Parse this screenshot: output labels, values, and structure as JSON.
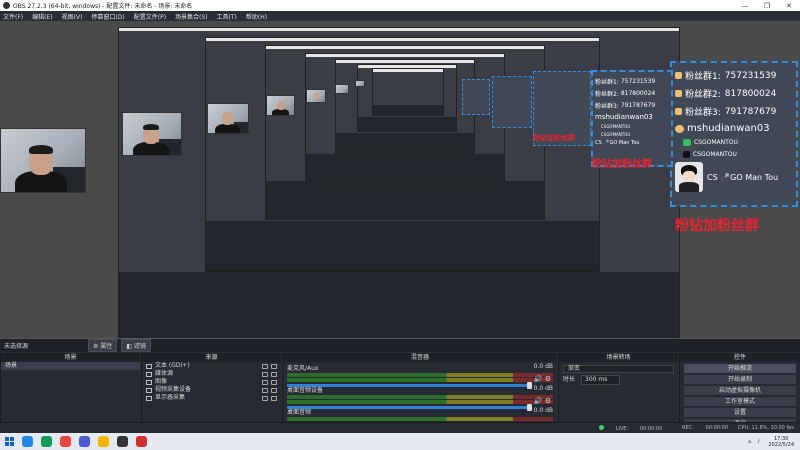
{
  "window": {
    "title": "OBS 27.2.3 (64-bit, windows) - 配置文件: 未命名 - 场景: 未命名",
    "controls": [
      "—",
      "❐",
      "✕"
    ]
  },
  "menu": [
    "文件(F)",
    "编辑(E)",
    "视图(V)",
    "停靠窗口(D)",
    "配置文件(P)",
    "场景集合(S)",
    "工具(T)",
    "帮助(H)"
  ],
  "fan_panel": {
    "rows": [
      {
        "label": "粉丝群1:",
        "value": "757231539"
      },
      {
        "label": "粉丝群2:",
        "value": "817800024"
      },
      {
        "label": "粉丝群3:",
        "value": "791787679"
      }
    ],
    "wechat_handle": "mshudianwan03",
    "wechat_small": "CSGOMANTOU",
    "douyin_handle": "CSGOMANTOU",
    "avatar_caption": "CS 🎤GO Man Tou",
    "avatar_caption_small": "CS 🎤GO Man Tou",
    "red_banner": "粉钻加粉丝群"
  },
  "scene_bar": {
    "label": "未选择源",
    "properties_btn": "⚙ 属性",
    "filters_btn": "◧ 滤镜"
  },
  "scenes": {
    "header": "场景",
    "items": [
      "场景"
    ],
    "footer": [
      "+",
      "−",
      "∧",
      "∨"
    ]
  },
  "sources": {
    "header": "来源",
    "items": [
      "文本 (GDI+)",
      "媒体源",
      "图像",
      "视频采集设备",
      "显示器采集"
    ],
    "footer": [
      "+",
      "−",
      "⚙",
      "∧",
      "∨"
    ]
  },
  "mixer": {
    "header": "混音器",
    "channels": [
      {
        "name": "麦克风/Aux",
        "db": "0.0 dB",
        "level": 0.0
      },
      {
        "name": "桌面音频设备",
        "db": "0.0 dB",
        "level": 0.0
      },
      {
        "name": "桌面音频",
        "db": "0.0 dB",
        "level": 0.0
      }
    ]
  },
  "transitions": {
    "header": "场景转场",
    "type": "渐变",
    "duration_label": "时长",
    "duration_value": "300 ms"
  },
  "controls": {
    "header": "控件",
    "buttons": [
      "开始推流",
      "开始录制",
      "启动虚拟摄像机",
      "工作室模式",
      "设置",
      "退出"
    ]
  },
  "status": {
    "live_label": "LIVE:",
    "live_time": "00:00:00",
    "rec_label": "REC:",
    "rec_time": "00:00:00",
    "cpu": "CPU: 11.8%, 30.00 fps"
  },
  "taskbar": {
    "apps": [
      "explorer",
      "edge",
      "chrome",
      "obs-shield",
      "chrome-colored",
      "obs",
      "record"
    ],
    "app_colors": [
      "#1e88e5",
      "#0f9d58",
      "#e8453c",
      "#4b5bd6",
      "#f4b400",
      "#333333",
      "#d32f2f"
    ],
    "time": "17:30",
    "date": "2022/5/24"
  },
  "colors": {
    "panel_border": "#2f8fe0",
    "red_text": "#e8232d"
  }
}
